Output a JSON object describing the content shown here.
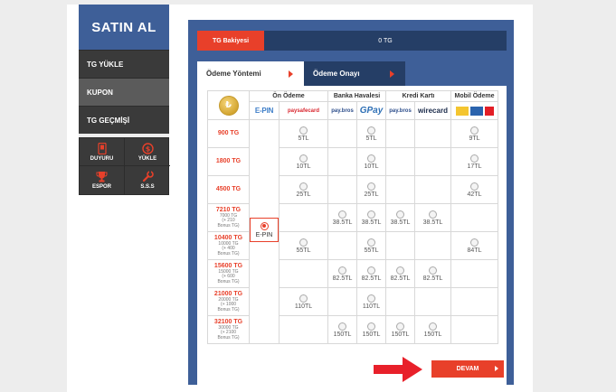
{
  "sidebar": {
    "title": "SATIN AL",
    "items": [
      {
        "label": "TG YÜKLE"
      },
      {
        "label": "KUPON"
      },
      {
        "label": "TG GEÇMİŞİ"
      }
    ],
    "grid": [
      {
        "label": "DUYURU",
        "icon": "phone-icon"
      },
      {
        "label": "YÜKLE",
        "icon": "dollar-coin-icon"
      },
      {
        "label": "ESPOR",
        "icon": "trophy-icon"
      },
      {
        "label": "S.S.S",
        "icon": "wrench-icon"
      }
    ]
  },
  "balance": {
    "label": "TG Bakiyesi",
    "value": "0 TG"
  },
  "tabs": [
    {
      "label": "Ödeme Yöntemi"
    },
    {
      "label": "Ödeme Onayı"
    }
  ],
  "table": {
    "groups": [
      "Ön Ödeme",
      "Banka Havalesi",
      "Kredi Kartı",
      "Mobil Ödeme"
    ],
    "logos": {
      "epin": "E-PIN",
      "paysafecard": "paysafecard",
      "paybros": "pay.bros",
      "gpay": "GPay",
      "wirecard": "wirecard"
    },
    "selected_label": "E-PIN",
    "rows": [
      {
        "amount": "900 TG",
        "sub": [],
        "prices": [
          "5TL",
          "",
          "5TL",
          "",
          "",
          "9TL"
        ]
      },
      {
        "amount": "1800 TG",
        "sub": [],
        "prices": [
          "10TL",
          "",
          "10TL",
          "",
          "",
          "17TL"
        ]
      },
      {
        "amount": "4500 TG",
        "sub": [],
        "prices": [
          "25TL",
          "",
          "25TL",
          "",
          "",
          "42TL"
        ]
      },
      {
        "amount": "7210 TG",
        "sub": [
          "7000 TG",
          "(+ 210",
          "Bonus TG)"
        ],
        "prices": [
          "",
          "38.5TL",
          "38.5TL",
          "38.5TL",
          "38.5TL",
          ""
        ]
      },
      {
        "amount": "10400 TG",
        "sub": [
          "10000 TG",
          "(+ 400",
          "Bonus TG)"
        ],
        "prices": [
          "55TL",
          "",
          "55TL",
          "",
          "",
          "84TL"
        ]
      },
      {
        "amount": "15600 TG",
        "sub": [
          "15000 TG",
          "(+ 600",
          "Bonus TG)"
        ],
        "prices": [
          "",
          "82.5TL",
          "82.5TL",
          "82.5TL",
          "82.5TL",
          ""
        ]
      },
      {
        "amount": "21000 TG",
        "sub": [
          "20000 TG",
          "(+ 1000",
          "Bonus TG)"
        ],
        "prices": [
          "110TL",
          "",
          "110TL",
          "",
          "",
          ""
        ]
      },
      {
        "amount": "32100 TG",
        "sub": [
          "30000 TG",
          "(+ 2100",
          "Bonus TG)"
        ],
        "prices": [
          "",
          "150TL",
          "150TL",
          "150TL",
          "150TL",
          ""
        ]
      }
    ]
  },
  "continue_label": "DEVAM",
  "colors": {
    "accent": "#e8402a",
    "brand": "#3e5f98",
    "dark": "#253e66",
    "sidebar": "#3a3a3a"
  }
}
